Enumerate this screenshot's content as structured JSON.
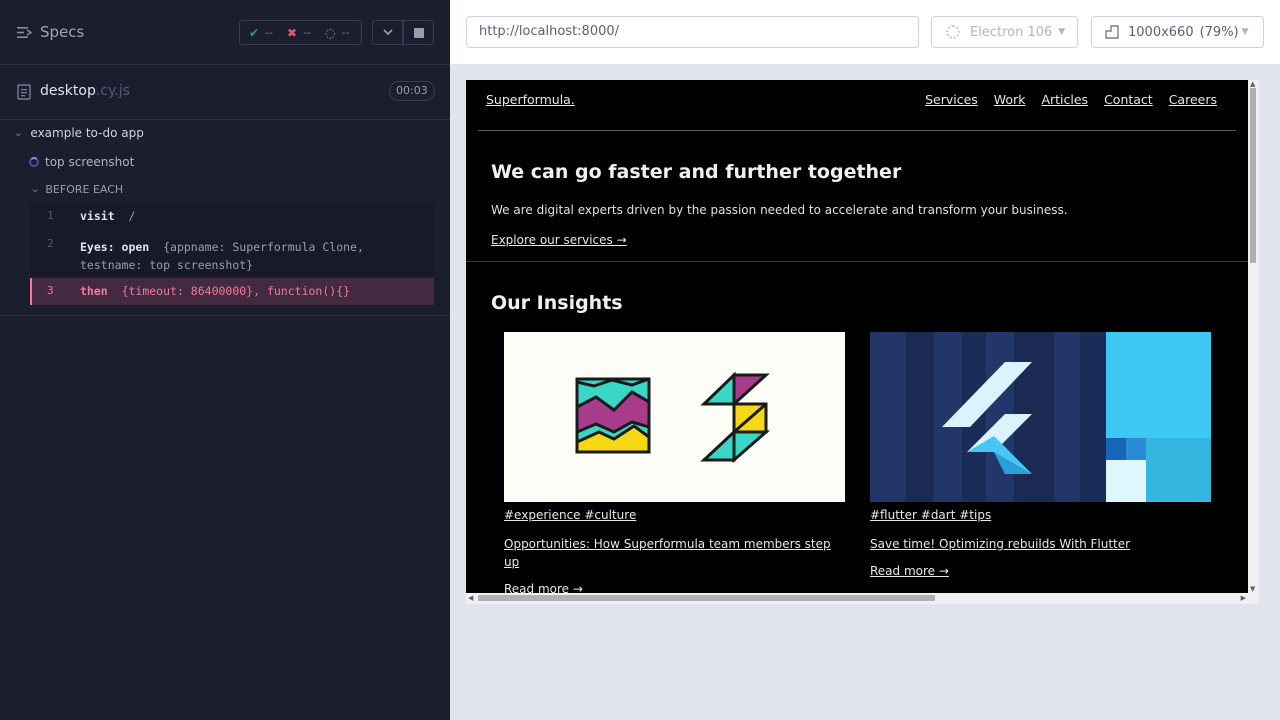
{
  "reporter": {
    "specs_label": "Specs",
    "stats": {
      "passed": "--",
      "failed": "--",
      "pending": "--"
    },
    "spec": {
      "name": "desktop",
      "ext": ".cy.js",
      "duration": "00:03"
    },
    "suite": "example to-do app",
    "test": "top screenshot",
    "hook": "BEFORE EACH",
    "commands": [
      {
        "num": "1",
        "name": "visit",
        "args": "/"
      },
      {
        "num": "2",
        "name": "Eyes: open",
        "args": "{appname: Superformula Clone, testname: top screenshot}"
      },
      {
        "num": "3",
        "name": "then",
        "args": "{timeout: 86400000}, function(){}"
      }
    ]
  },
  "aut": {
    "url": "http://localhost:8000/",
    "browser": "Electron 106",
    "viewport": "1000x660",
    "scale": "(79%)"
  },
  "site": {
    "brand": "Superformula.",
    "nav": [
      "Services",
      "Work",
      "Articles",
      "Contact",
      "Careers"
    ],
    "hero_title": "We can go faster and further together",
    "hero_text": "We are digital experts driven by the passion needed to accelerate and transform your business.",
    "hero_link": "Explore our services →",
    "insights_title": "Our Insights",
    "cards": [
      {
        "tags": "#experience #culture",
        "title": "Opportunities: How Superformula team members step up",
        "more": "Read more →"
      },
      {
        "tags": "#flutter #dart #tips",
        "title": "Save time! Optimizing rebuilds With Flutter",
        "more": "Read more →"
      }
    ]
  },
  "colors": {
    "reporter_bg": "#1b1e2e",
    "failing_accent": "#f07aa0",
    "passed": "#1fa971",
    "failed": "#e45770"
  }
}
